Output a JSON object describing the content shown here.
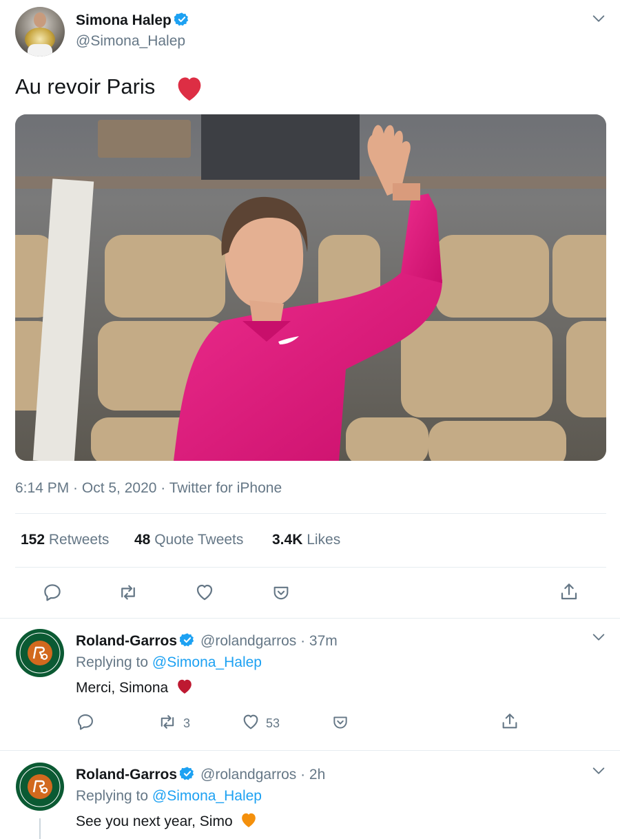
{
  "main_tweet": {
    "author": {
      "name": "Simona Halep",
      "handle": "@Simona_Halep",
      "verified": true
    },
    "text": "Au revoir Paris",
    "emoji": "heart-red",
    "media_description_icon": "photo",
    "meta": "6:14 PM · Oct 5, 2020 · Twitter for iPhone",
    "stats": {
      "retweets_count": "152",
      "retweets_label": "Retweets",
      "quote_count": "48",
      "quote_label": "Quote Tweets",
      "likes_count": "3.4K",
      "likes_label": "Likes"
    },
    "actions": [
      "reply-icon",
      "retweet-icon",
      "like-icon",
      "bookmark-icon",
      "share-icon"
    ]
  },
  "replies": [
    {
      "author": {
        "name": "Roland-Garros",
        "handle": "@rolandgarros",
        "verified": true
      },
      "time": "37m",
      "replying_prefix": "Replying to",
      "replying_to": "@Simona_Halep",
      "text": "Merci, Simona",
      "emoji": "heart-darkred",
      "retweets": "3",
      "likes": "53"
    },
    {
      "author": {
        "name": "Roland-Garros",
        "handle": "@rolandgarros",
        "verified": true
      },
      "time": "2h",
      "replying_prefix": "Replying to",
      "replying_to": "@Simona_Halep",
      "text": "See you next year, Simo",
      "emoji": "heart-orange"
    }
  ],
  "colors": {
    "accent": "#1da1f2",
    "text": "#14171a",
    "muted": "#657786",
    "divider": "#e6ecf0",
    "shirt_pink": "#e0157a",
    "rg_green": "#0b5a33",
    "rg_orange": "#d2691e"
  }
}
